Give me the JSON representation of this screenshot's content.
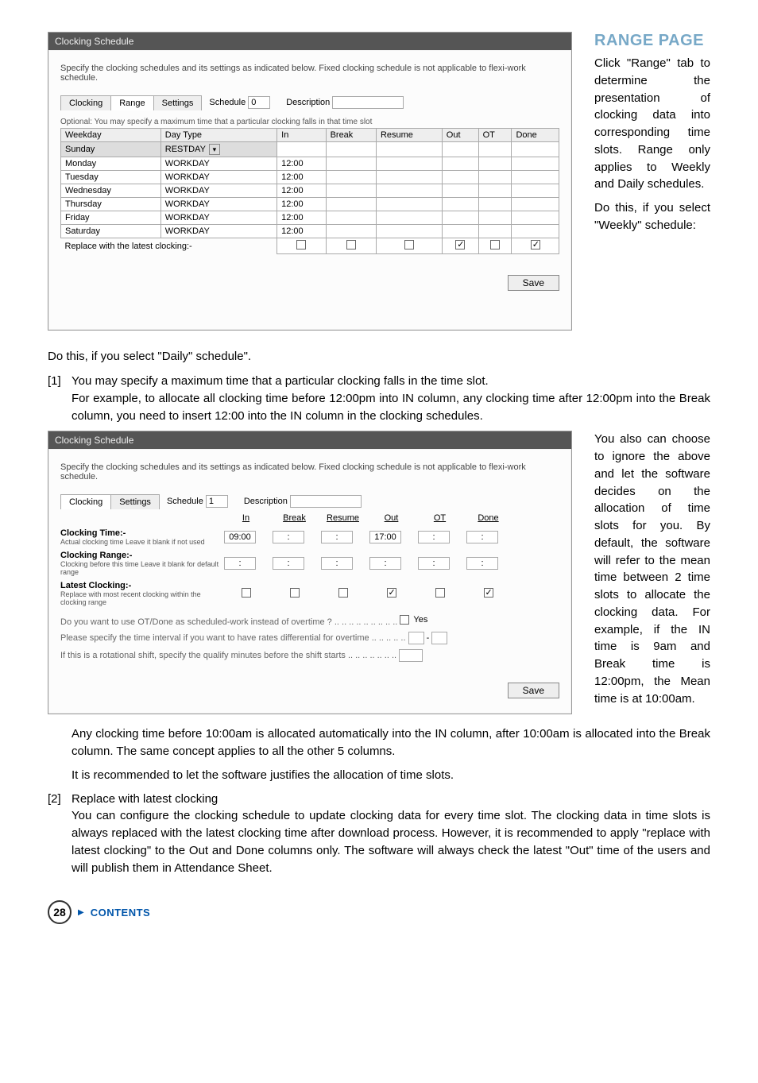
{
  "page_number": "28",
  "contents_label": "CONTENTS",
  "range_heading": "RANGE PAGE",
  "range_p1": "Click \"Range\" tab to determine the presentation of clocking data into corresponding time slots. Range only applies to Weekly and Daily schedules.",
  "range_p2": "Do this, if you select \"Weekly\" schedule:",
  "daily_schedule_line": "Do this, if you select \"Daily\" schedule\".",
  "item1_num": "[1]",
  "item1_line1": "You may specify a maximum time that a particular clocking falls in the time slot.",
  "item1_line2": "For example, to allocate all clocking time before 12:00pm into IN column, any clocking time after 12:00pm into the Break column, you need to insert 12:00 into the IN column in the clocking schedules.",
  "midright_p": "You also can choose to ignore the above and let the software decides on the allocation of time slots for you. By default, the software will refer to the mean time between 2 time slots to allocate the clocking data. For example, if the IN time is 9am and Break time is 12:00pm, the Mean time is at 10:00am.",
  "after_mid_p1": "Any clocking time before 10:00am is allocated automatically into the IN column, after 10:00am is allocated into the Break column. The same concept applies to all the other 5 columns.",
  "after_mid_p2": "It is recommended to let the software justifies the allocation of time slots.",
  "item2_num": "[2]",
  "item2_title": "Replace with latest clocking",
  "item2_body": "You can configure the clocking schedule to update clocking data for every time slot. The clocking data in time slots is always replaced with the latest clocking time after download process. However, it is recommended to apply \"replace with latest clocking\" to the Out and Done columns only. The software will always check the latest \"Out\" time of the users and will publish them in Attendance Sheet.",
  "screenshot1": {
    "title": "Clocking Schedule",
    "desc": "Specify the clocking schedules and its settings as indicated below. Fixed clocking schedule is not applicable to flexi-work schedule.",
    "tabs": {
      "clocking": "Clocking",
      "range": "Range",
      "settings": "Settings"
    },
    "schedule_label": "Schedule",
    "schedule_value": "0",
    "description_label": "Description",
    "optional_line": "Optional: You may specify a maximum time that a particular clocking falls in that time slot",
    "headers": [
      "Weekday",
      "Day Type",
      "In",
      "Break",
      "Resume",
      "Out",
      "OT",
      "Done"
    ],
    "rows": [
      {
        "weekday": "Sunday",
        "daytype": "RESTDAY",
        "in": "",
        "dropdown": true
      },
      {
        "weekday": "Monday",
        "daytype": "WORKDAY",
        "in": "12:00"
      },
      {
        "weekday": "Tuesday",
        "daytype": "WORKDAY",
        "in": "12:00"
      },
      {
        "weekday": "Wednesday",
        "daytype": "WORKDAY",
        "in": "12:00"
      },
      {
        "weekday": "Thursday",
        "daytype": "WORKDAY",
        "in": "12:00"
      },
      {
        "weekday": "Friday",
        "daytype": "WORKDAY",
        "in": "12:00"
      },
      {
        "weekday": "Saturday",
        "daytype": "WORKDAY",
        "in": "12:00"
      }
    ],
    "replace_label": "Replace with the latest clocking:-",
    "replace_checks": [
      false,
      false,
      false,
      true,
      false,
      true
    ],
    "save": "Save"
  },
  "screenshot2": {
    "title": "Clocking Schedule",
    "desc": "Specify the clocking schedules and its settings as indicated below. Fixed clocking schedule is not applicable to flexi-work schedule.",
    "tabs": {
      "clocking": "Clocking",
      "settings": "Settings"
    },
    "schedule_label": "Schedule",
    "schedule_value": "1",
    "description_label": "Description",
    "cols": [
      "In",
      "Break",
      "Resume",
      "Out",
      "OT",
      "Done"
    ],
    "row_clocking_time": {
      "label": "Clocking Time:-",
      "sub": "Actual clocking time\nLeave it blank if not used",
      "vals": [
        "09:00",
        ":",
        ":",
        "17:00",
        ":",
        ":"
      ]
    },
    "row_clocking_range": {
      "label": "Clocking Range:-",
      "sub": "Clocking before this time\nLeave it blank for default range",
      "vals": [
        ":",
        ":",
        ":",
        ":",
        ":",
        ":"
      ]
    },
    "row_latest": {
      "label": "Latest Clocking:-",
      "sub": "Replace with most recent clocking within the clocking range",
      "checks": [
        false,
        false,
        false,
        true,
        false,
        true
      ]
    },
    "line_ot": "Do you want to use OT/Done as scheduled-work instead of overtime ? .. .. .. .. .. .. .. .. ..",
    "ot_yes": "Yes",
    "line_rates": "Please specify the time interval if you want to have rates differential for overtime  .. .. .. .. ..",
    "rates_val": "-",
    "line_rotational": "If this is a rotational shift, specify the qualify minutes before the shift starts .. .. .. .. .. .. ..",
    "save": "Save"
  }
}
